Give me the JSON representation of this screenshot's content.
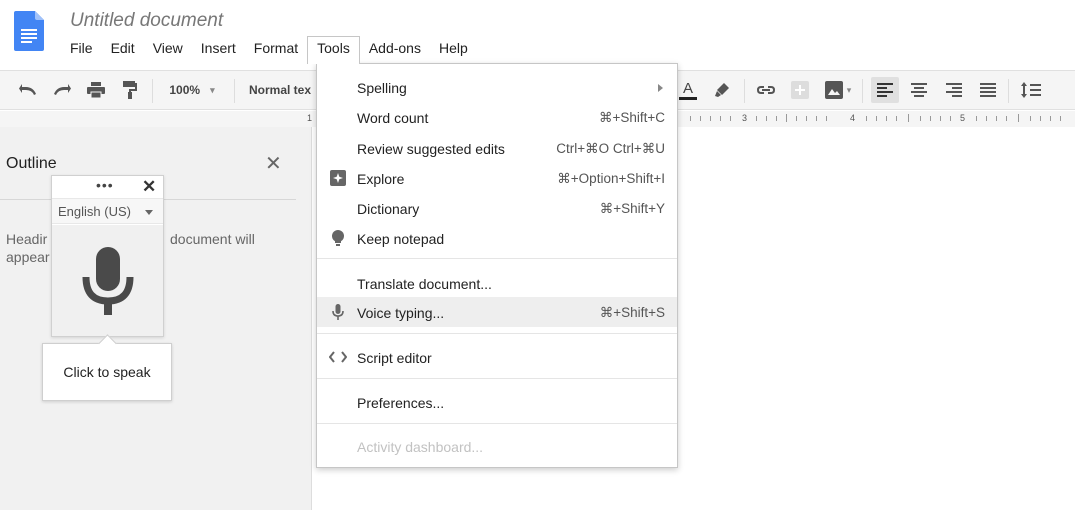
{
  "document": {
    "title": "Untitled document"
  },
  "menubar": {
    "items": [
      "File",
      "Edit",
      "View",
      "Insert",
      "Format",
      "Tools",
      "Add-ons",
      "Help"
    ],
    "active": "Tools"
  },
  "toolbar": {
    "zoom": "100%",
    "style": "Normal tex",
    "icons": [
      "undo-icon",
      "redo-icon",
      "print-icon",
      "paint-format-icon",
      "text-color-icon",
      "highlight-icon",
      "link-icon",
      "comment-icon",
      "image-icon",
      "align-left-icon",
      "align-center-icon",
      "align-right-icon",
      "justify-icon",
      "line-spacing-icon"
    ]
  },
  "ruler": {
    "numbers": [
      "1",
      "3",
      "4",
      "5"
    ]
  },
  "outline": {
    "title": "Outline",
    "empty_text_left_1": "Headir",
    "empty_text_left_2": "appear",
    "empty_text_right": "document will"
  },
  "voice_widget": {
    "more": "•••",
    "close": "✕",
    "language": "English (US)",
    "tooltip": "Click to speak"
  },
  "tools_menu": {
    "items": [
      {
        "label": "Spelling",
        "shortcut": "",
        "icon": "",
        "submenu": true
      },
      {
        "label": "Word count",
        "shortcut": "⌘+Shift+C",
        "icon": ""
      },
      {
        "label": "Review suggested edits",
        "shortcut": "Ctrl+⌘O Ctrl+⌘U",
        "icon": ""
      },
      {
        "label": "Explore",
        "shortcut": "⌘+Option+Shift+I",
        "icon": "explore-icon"
      },
      {
        "label": "Dictionary",
        "shortcut": "⌘+Shift+Y",
        "icon": ""
      },
      {
        "label": "Keep notepad",
        "shortcut": "",
        "icon": "keep-bulb-icon"
      },
      {
        "label": "Translate document...",
        "shortcut": "",
        "icon": ""
      },
      {
        "label": "Voice typing...",
        "shortcut": "⌘+Shift+S",
        "icon": "microphone-icon",
        "highlighted": true
      },
      {
        "label": "Script editor",
        "shortcut": "",
        "icon": "code-icon"
      },
      {
        "label": "Preferences...",
        "shortcut": "",
        "icon": ""
      },
      {
        "label": "Activity dashboard...",
        "shortcut": "",
        "icon": "",
        "disabled": true
      }
    ]
  },
  "colors": {
    "doc_icon": "#4285f4",
    "panel_bg": "#f1f1f1",
    "toolbar_bg": "#f5f5f5",
    "menu_highlight": "#eeeeee"
  }
}
